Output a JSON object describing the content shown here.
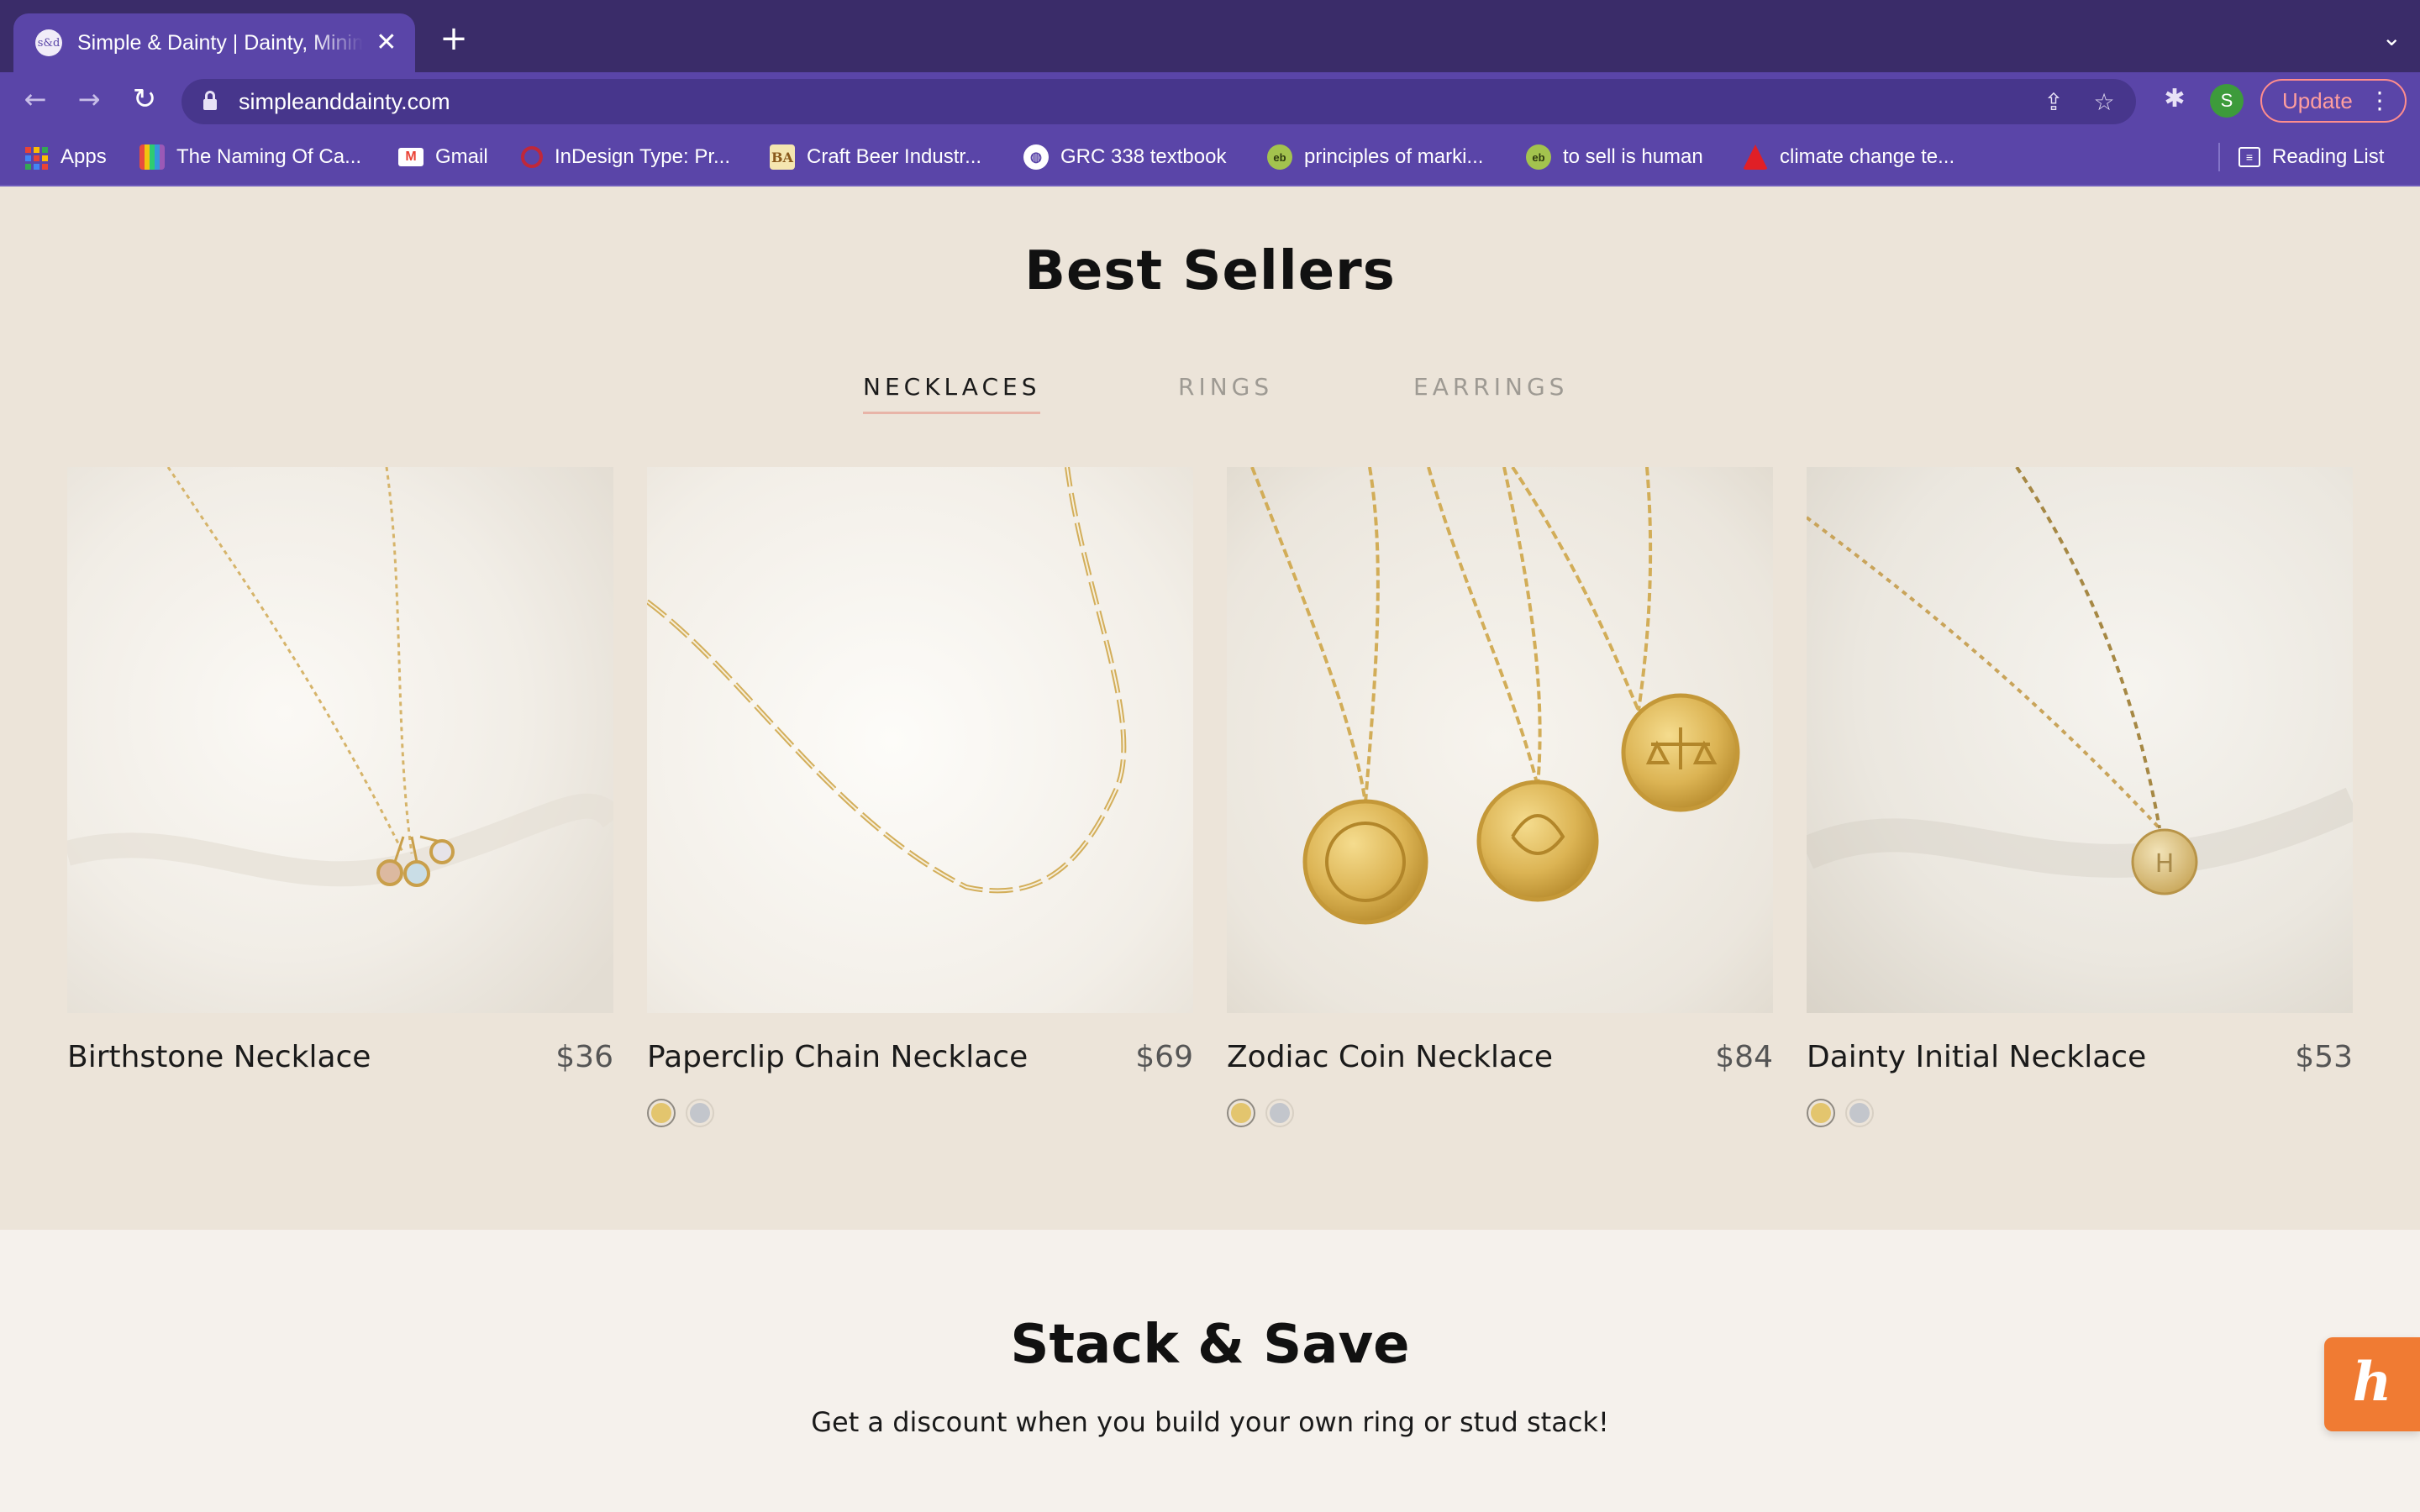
{
  "browser": {
    "tab_title": "Simple & Dainty | Dainty, Minimalist",
    "tab_favicon_text": "s&d",
    "tab_close": "✕",
    "new_tab": "+",
    "tab_menu": "⌄",
    "url": "simpleanddainty.com",
    "update_label": "Update",
    "avatar_letter": "S",
    "bookmarks": [
      {
        "label": "Apps",
        "icon": "apps-grid-icon"
      },
      {
        "label": "The Naming Of Ca...",
        "icon": "book-icon"
      },
      {
        "label": "Gmail",
        "icon": "gmail-icon"
      },
      {
        "label": "InDesign Type: Pr...",
        "icon": "indesign-icon"
      },
      {
        "label": "Craft Beer Industr...",
        "icon": "craft-beer-icon"
      },
      {
        "label": "GRC 338 textbook",
        "icon": "globe-icon"
      },
      {
        "label": "principles of marki...",
        "icon": "eb-icon"
      },
      {
        "label": "to sell is human",
        "icon": "eb-icon"
      },
      {
        "label": "climate change te...",
        "icon": "adobe-icon"
      }
    ],
    "reading_list": "Reading List"
  },
  "page": {
    "best_sellers_title": "Best Sellers",
    "tabs": [
      "NECKLACES",
      "RINGS",
      "EARRINGS"
    ],
    "active_tab": "NECKLACES",
    "products": [
      {
        "name": "Birthstone Necklace",
        "price": "$36",
        "swatches": []
      },
      {
        "name": "Paperclip Chain Necklace",
        "price": "$69",
        "swatches": [
          "gold",
          "silver"
        ]
      },
      {
        "name": "Zodiac Coin Necklace",
        "price": "$84",
        "swatches": [
          "gold",
          "silver"
        ]
      },
      {
        "name": "Dainty Initial Necklace",
        "price": "$53",
        "swatches": [
          "gold",
          "silver"
        ]
      }
    ],
    "initial_pendant_letter": "H",
    "stack_title": "Stack & Save",
    "stack_subtitle": "Get a discount when you build your own ring or stud stack!",
    "honey_letter": "h"
  },
  "colors": {
    "chrome_dark": "#3a2c69",
    "chrome_toolbar": "#5a45a8",
    "page_bg": "#ece4d9",
    "stack_bg": "#f5f1ec",
    "gold_swatch": "#e3c56e",
    "silver_swatch": "#c3c6cc",
    "honey_orange": "#f07b33"
  }
}
